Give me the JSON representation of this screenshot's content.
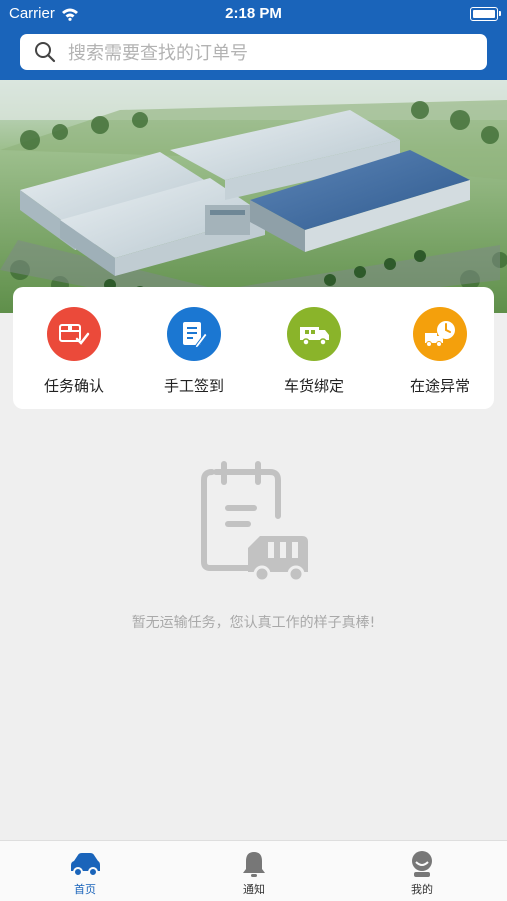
{
  "status_bar": {
    "carrier": "Carrier",
    "time": "2:18 PM"
  },
  "search": {
    "placeholder": "搜索需要查找的订单号"
  },
  "actions": [
    {
      "label": "任务确认",
      "icon": "package-check-icon",
      "color": "#eb4a3a"
    },
    {
      "label": "手工签到",
      "icon": "note-pen-icon",
      "color": "#1b77d2"
    },
    {
      "label": "车货绑定",
      "icon": "delivery-van-icon",
      "color": "#8ab42a"
    },
    {
      "label": "在途异常",
      "icon": "truck-clock-icon",
      "color": "#f4a00c"
    }
  ],
  "empty_state": {
    "message": "暂无运输任务，您认真工作的样子真棒!"
  },
  "tabbar": {
    "items": [
      {
        "label": "首页",
        "icon": "car-icon",
        "active": true
      },
      {
        "label": "通知",
        "icon": "bell-icon",
        "active": false
      },
      {
        "label": "我的",
        "icon": "user-icon",
        "active": false
      }
    ]
  },
  "colors": {
    "primary": "#1a64ba",
    "background": "#efefef",
    "muted_text": "#a9a9a9"
  }
}
